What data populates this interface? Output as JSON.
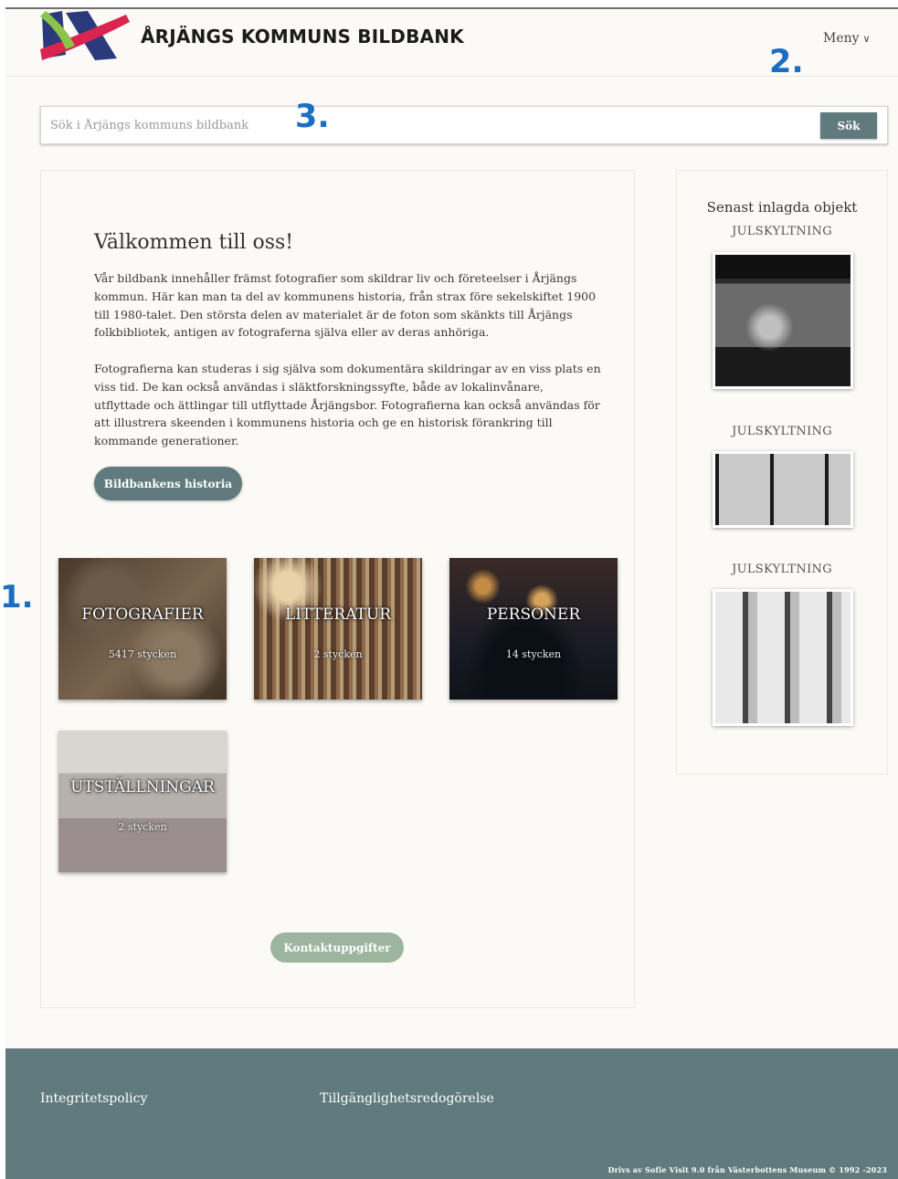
{
  "header": {
    "site_title": "ÅRJÄNGS KOMMUNS BILDBANK",
    "menu_label": "Meny"
  },
  "markers": {
    "one": "1.",
    "two": "2.",
    "three": "3."
  },
  "search": {
    "placeholder": "Sök i Årjängs kommuns bildbank",
    "button_label": "Sök"
  },
  "main": {
    "welcome_title": "Välkommen till oss!",
    "para1": "Vår bildbank innehåller främst fotografier som skildrar liv och företeelser i Årjängs kommun. Här kan man ta del av kommunens historia, från strax före sekelskiftet 1900 till 1980-talet. Den största delen av materialet är de foton som skänkts till Årjängs folkbibliotek, antigen av fotograferna själva eller av deras anhöriga.",
    "para2": "Fotografierna kan studeras i sig själva som dokumentära skildringar av en viss plats en viss tid. De kan också användas i släktforskningssyfte, både av lokalinvånare, utflyttade och ättlingar till utflyttade Årjängsbor. Fotografierna kan också användas för att illustrera skeenden i kommunens historia och ge en historisk förankring till kommande generationer.",
    "history_button": "Bildbankens historia",
    "categories": [
      {
        "title": "FOTOGRAFIER",
        "count": "5417 stycken"
      },
      {
        "title": "LITTERATUR",
        "count": "2 stycken"
      },
      {
        "title": "PERSONER",
        "count": "14 stycken"
      },
      {
        "title": "UTSTÄLLNINGAR",
        "count": "2 stycken"
      }
    ],
    "contact_button": "Kontaktuppgifter"
  },
  "sidebar": {
    "title": "Senast inlagda objekt",
    "objects": [
      {
        "label": "JULSKYLTNING"
      },
      {
        "label": "JULSKYLTNING"
      },
      {
        "label": "JULSKYLTNING"
      }
    ]
  },
  "footer": {
    "privacy": "Integritetspolicy",
    "accessibility": "Tillgänglighetsredogörelse",
    "credit": "Drivs av Sofie Visit 9.0 från Västerbottens Museum © 1992 -2023"
  },
  "colors": {
    "accent": "#607a7d",
    "contact": "#9db59e",
    "marker": "#1a6fc2",
    "background": "#fcfaf6"
  }
}
